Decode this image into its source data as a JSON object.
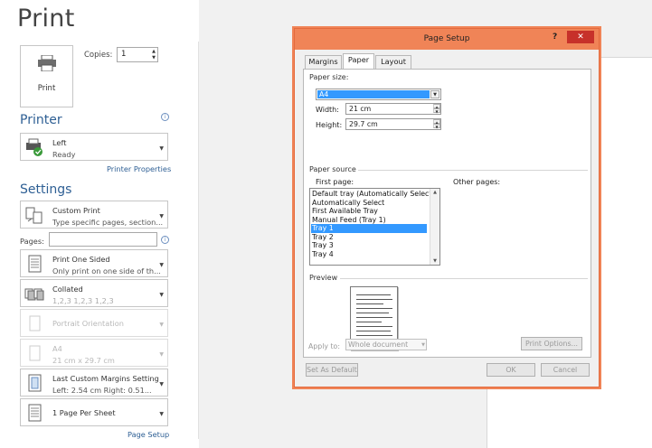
{
  "page": {
    "title": "Print"
  },
  "print_button": {
    "label": "Print"
  },
  "copies": {
    "label": "Copies:",
    "value": "1"
  },
  "printer": {
    "heading": "Printer",
    "name": "Left",
    "status": "Ready",
    "properties_link": "Printer Properties"
  },
  "settings": {
    "heading": "Settings",
    "pages_label": "Pages:",
    "items": [
      {
        "title": "Custom Print",
        "sub": "Type specific pages, section...",
        "icon": "custom-print-icon",
        "disabled": false
      },
      {
        "title": "Print One Sided",
        "sub": "Only print on one side of th...",
        "icon": "one-sided-icon",
        "disabled": false
      },
      {
        "title": "Collated",
        "sub": "1,2,3    1,2,3    1,2,3",
        "icon": "collated-icon",
        "disabled": false
      },
      {
        "title": "Portrait Orientation",
        "sub": "",
        "icon": "portrait-icon",
        "disabled": true
      },
      {
        "title": "A4",
        "sub": "21 cm x 29.7 cm",
        "icon": "paper-size-icon",
        "disabled": true
      },
      {
        "title": "Last Custom Margins Setting",
        "sub": "Left:  2.54 cm    Right:  0.51...",
        "icon": "margins-icon",
        "disabled": false
      },
      {
        "title": "1 Page Per Sheet",
        "sub": "",
        "icon": "pages-per-sheet-icon",
        "disabled": false
      }
    ],
    "page_setup_link": "Page Setup"
  },
  "dialog": {
    "title": "Page Setup",
    "help": "?",
    "close": "✕",
    "tabs": [
      "Margins",
      "Paper",
      "Layout"
    ],
    "active_tab": "Paper",
    "paper_size": {
      "heading": "Paper size:",
      "selected": "A4",
      "width_label": "Width:",
      "width_value": "21 cm",
      "height_label": "Height:",
      "height_value": "29.7 cm"
    },
    "paper_source": {
      "heading": "Paper source",
      "first_page_label": "First page:",
      "other_pages_label": "Other pages:",
      "options": [
        "Default tray (Automatically Select)",
        "Automatically Select",
        "First Available Tray",
        "Manual Feed (Tray 1)",
        "Tray 1",
        "Tray 2",
        "Tray 3",
        "Tray 4"
      ],
      "selected_index": 4
    },
    "preview": {
      "heading": "Preview"
    },
    "apply_to": {
      "label": "Apply to:",
      "value": "Whole document"
    },
    "buttons": {
      "print_options": "Print Options...",
      "set_default": "Set As Default",
      "ok": "OK",
      "cancel": "Cancel"
    }
  },
  "colors": {
    "accent_blue": "#2e5f94",
    "titlebar": "#f08457",
    "selection": "#3399ff",
    "close_red": "#c7312a"
  }
}
